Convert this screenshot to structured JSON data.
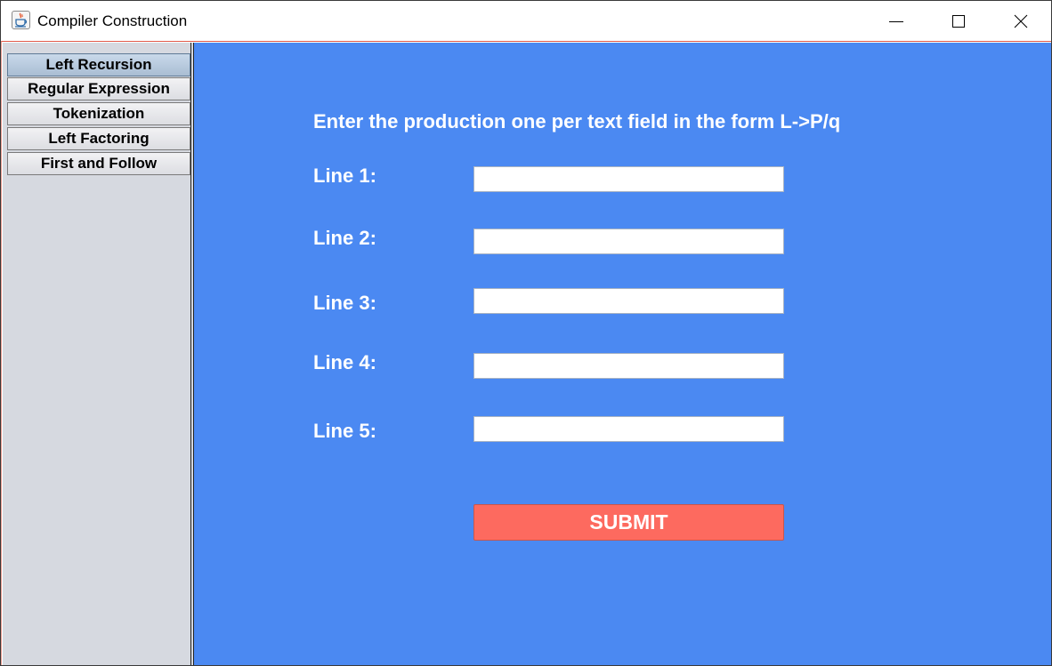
{
  "window": {
    "title": "Compiler Construction",
    "app_icon": "java-coffee-cup-icon",
    "controls": {
      "minimize": "minimize-icon",
      "maximize": "maximize-icon",
      "close": "close-icon"
    }
  },
  "sidebar": {
    "items": [
      {
        "label": "Left Recursion",
        "active": true
      },
      {
        "label": "Regular Expression",
        "active": false
      },
      {
        "label": "Tokenization",
        "active": false
      },
      {
        "label": "Left Factoring",
        "active": false
      },
      {
        "label": "First and Follow",
        "active": false
      }
    ]
  },
  "main": {
    "instruction": "Enter the production one per text field in the form L->P/q",
    "lines": [
      {
        "label": "Line 1:",
        "value": ""
      },
      {
        "label": "Line 2:",
        "value": ""
      },
      {
        "label": "Line 3:",
        "value": ""
      },
      {
        "label": "Line 4:",
        "value": ""
      },
      {
        "label": "Line 5:",
        "value": ""
      }
    ],
    "submit_label": "SUBMIT"
  },
  "colors": {
    "panel_background": "#4b89f2",
    "sidebar_background": "#d6d9e0",
    "submit_background": "#fd6a5f",
    "active_tab": "#b4c7dc",
    "text_on_panel": "#ffffff"
  }
}
